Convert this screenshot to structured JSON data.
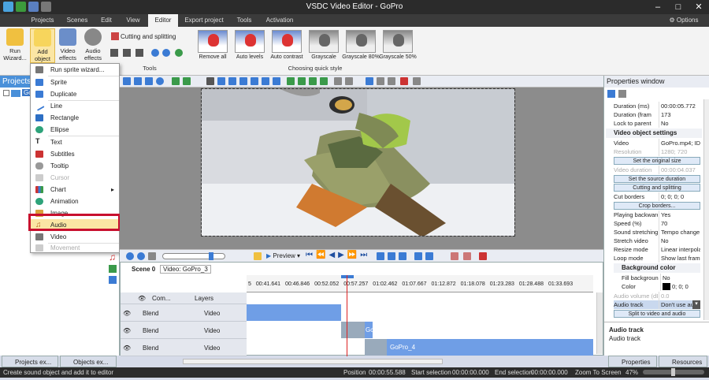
{
  "window": {
    "title": "VSDC Video Editor - GoPro"
  },
  "menu": {
    "items": [
      "Projects",
      "Scenes",
      "Edit",
      "View",
      "Editor",
      "Export project",
      "Tools",
      "Activation"
    ],
    "active": "Editor",
    "options": "Options"
  },
  "ribbon": {
    "run_wizard": "Run Wizard...",
    "add_object": "Add object",
    "video_effects": "Video effects",
    "audio_effects": "Audio effects",
    "cutting": "Cutting and splitting",
    "group_tools": "Tools",
    "group_quick_style": "Choosing quick style",
    "styles": [
      "Remove all",
      "Auto levels",
      "Auto contrast",
      "Grayscale",
      "Grayscale 80%",
      "Grayscale 50%"
    ]
  },
  "object_menu": {
    "items": [
      {
        "label": "Run sprite wizard...",
        "icon": "wand-icon",
        "disabled": false
      },
      {
        "label": "Sprite",
        "icon": "sprite-icon",
        "disabled": false
      },
      {
        "label": "Duplicate",
        "icon": "duplicate-icon",
        "disabled": false
      },
      {
        "label": "Line",
        "icon": "line-icon",
        "disabled": false
      },
      {
        "label": "Rectangle",
        "icon": "rectangle-icon",
        "disabled": false
      },
      {
        "label": "Ellipse",
        "icon": "ellipse-icon",
        "disabled": false
      },
      {
        "label": "Text",
        "icon": "text-icon",
        "disabled": false
      },
      {
        "label": "Subtitles",
        "icon": "subtitles-icon",
        "disabled": false
      },
      {
        "label": "Tooltip",
        "icon": "tooltip-icon",
        "disabled": false
      },
      {
        "label": "Cursor",
        "icon": "cursor-icon",
        "disabled": true
      },
      {
        "label": "Chart",
        "icon": "chart-icon",
        "disabled": false
      },
      {
        "label": "Animation",
        "icon": "animation-icon",
        "disabled": false
      },
      {
        "label": "Image",
        "icon": "image-icon",
        "disabled": false
      },
      {
        "label": "Audio",
        "icon": "music-note-icon",
        "disabled": false
      },
      {
        "label": "Video",
        "icon": "video-icon",
        "disabled": false
      },
      {
        "label": "Movement",
        "icon": "movement-icon",
        "disabled": true
      }
    ]
  },
  "projects_panel": {
    "title": "Projects",
    "tree_item": "Go"
  },
  "player": {
    "preview_label": "Preview"
  },
  "timeline": {
    "tabs": [
      "Scene 0",
      "Video: GoPro_3"
    ],
    "ruler": [
      "5",
      "00:41.641",
      "00:46.846",
      "00:52.052",
      "00:57.257",
      "01:02.462",
      "01:07.667",
      "01:12.872",
      "01:18.078",
      "01:23.283",
      "01:28.488",
      "01:33.693",
      "01:"
    ],
    "header": {
      "com": "Com...",
      "layers": "Layers"
    },
    "rows": [
      {
        "blend": "Blend",
        "layer": "Video"
      },
      {
        "blend": "Blend",
        "layer": "Video"
      },
      {
        "blend": "Blend",
        "layer": "Video"
      }
    ],
    "clips": [
      "",
      "Gc",
      "GoPro_4"
    ]
  },
  "properties": {
    "title": "Properties window",
    "rows_top": [
      {
        "k": "Duration (ms)",
        "v": "00:00:05.772"
      },
      {
        "k": "Duration (fram",
        "v": "173"
      },
      {
        "k": "Lock to parent",
        "v": "No"
      }
    ],
    "video_header": "Video object settings",
    "video_rows": [
      {
        "k": "Video",
        "v": "GoPro.mp4; ID="
      },
      {
        "k": "Resolution",
        "v": "1280; 720"
      }
    ],
    "btn_original": "Set the original size",
    "video_duration": {
      "k": "Video duration",
      "v": "00:00:04.037"
    },
    "btn_source": "Set the source duration",
    "btn_cut": "Cutting and splitting",
    "cut_borders": {
      "k": "Cut borders",
      "v": "0; 0; 0; 0"
    },
    "btn_crop": "Crop borders...",
    "rows_mid": [
      {
        "k": "Playing backward",
        "v": "Yes"
      },
      {
        "k": "Speed (%)",
        "v": "70"
      },
      {
        "k": "Sound stretching",
        "v": "Tempo change"
      },
      {
        "k": "Stretch video",
        "v": "No"
      },
      {
        "k": "Resize mode",
        "v": "Linear interpolat"
      },
      {
        "k": "Loop mode",
        "v": "Show last frame"
      }
    ],
    "bg_header": "Background color",
    "bg_rows": [
      {
        "k": "Fill backgroun",
        "v": "No"
      },
      {
        "k": "Color",
        "v": "0; 0; 0"
      }
    ],
    "audio_volume": {
      "k": "Audio volume (dB)",
      "v": "0.0"
    },
    "audio_track": {
      "k": "Audio track",
      "v": "Don't use au"
    },
    "btn_split": "Split to video and audio",
    "desc_title": "Audio track",
    "desc_text": "Audio track"
  },
  "bottom_tabs": [
    "Projects ex...",
    "Objects ex...",
    "Properties ...",
    "Resources ..."
  ],
  "status": {
    "hint": "Create sound object and add it to editor",
    "position": "Position",
    "position_v": "00:00:55.588",
    "start": "Start selection",
    "start_v": "00:00:00.000",
    "end": "End selection",
    "end_v": "00:00:00.000",
    "zoom": "Zoom To Screen",
    "zoom_v": "47%"
  }
}
